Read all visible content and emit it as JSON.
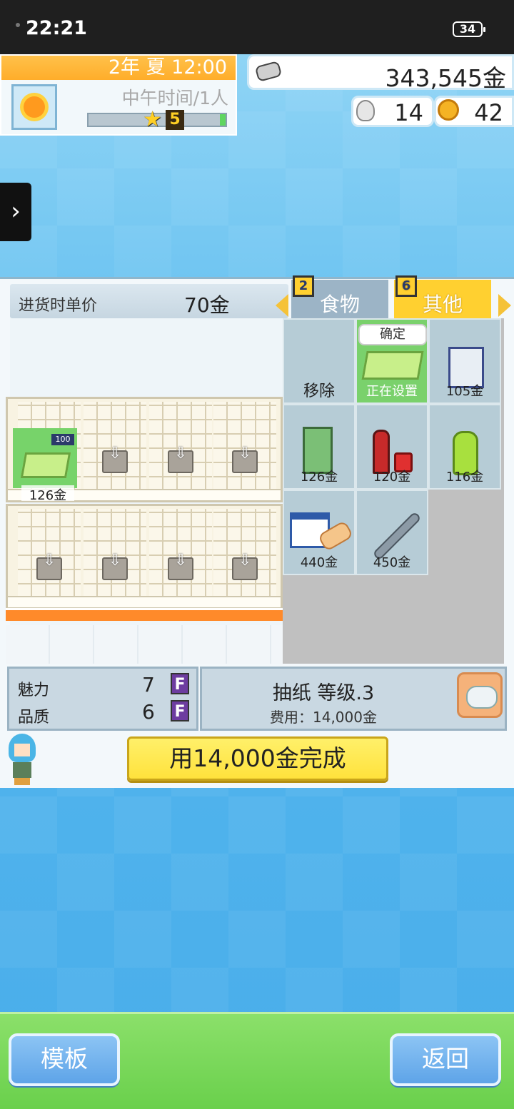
{
  "status_bar": {
    "time": "22:21",
    "battery": "34"
  },
  "hud": {
    "date": "2年 夏 12:00",
    "mode": "中午时间/1人",
    "star_level": "5",
    "money": "343,545金",
    "ideas": "14",
    "medals": "42"
  },
  "shop": {
    "price_label": "进货时单价",
    "price_value": "70金",
    "tabs": [
      {
        "label": "食物",
        "count": "2"
      },
      {
        "label": "其他",
        "count": "6"
      }
    ],
    "placed_price": "126金",
    "placed_tag": "100"
  },
  "items": {
    "remove": "移除",
    "confirm": "确定",
    "setting": "正在设置",
    "prices": [
      "105金",
      "126金",
      "120金",
      "116金",
      "440金",
      "450金"
    ]
  },
  "info": {
    "charm_label": "魅力",
    "charm_value": "7",
    "charm_rank": "F",
    "quality_label": "品质",
    "quality_value": "6",
    "quality_rank": "F",
    "item_name": "抽纸 等级.3",
    "cost": "费用：14,000金"
  },
  "actions": {
    "complete": "用14,000金完成",
    "template": "模板",
    "back": "返回"
  }
}
